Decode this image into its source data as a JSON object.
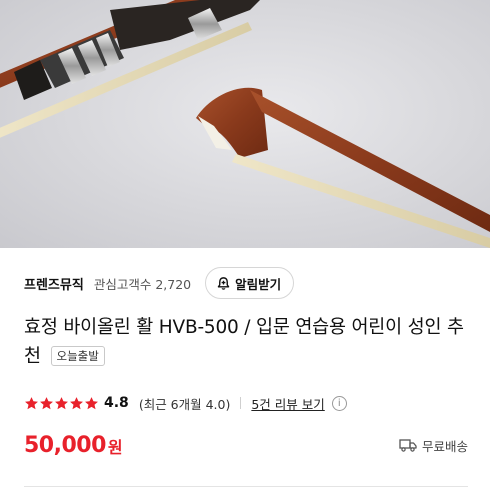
{
  "product_image": {
    "alt_icon": "violin-bow-image"
  },
  "seller": {
    "name": "프렌즈뮤직",
    "followers_label": "관심고객수",
    "followers_count": "2,720",
    "alarm_button_label": "알림받기"
  },
  "product": {
    "title": "효정 바이올린 활 HVB-500 / 입문 연습용 어린이 성인 추천",
    "badge": "오늘출발"
  },
  "rating": {
    "stars": 5,
    "value": "4.8",
    "detail": "(최근 6개월 4.0)",
    "review_link": "5건 리뷰 보기",
    "info_icon": "i",
    "star_color": "#e8212b"
  },
  "price": {
    "amount": "50,000",
    "currency": "원",
    "shipping": "무료배송",
    "color": "#e8212b"
  }
}
